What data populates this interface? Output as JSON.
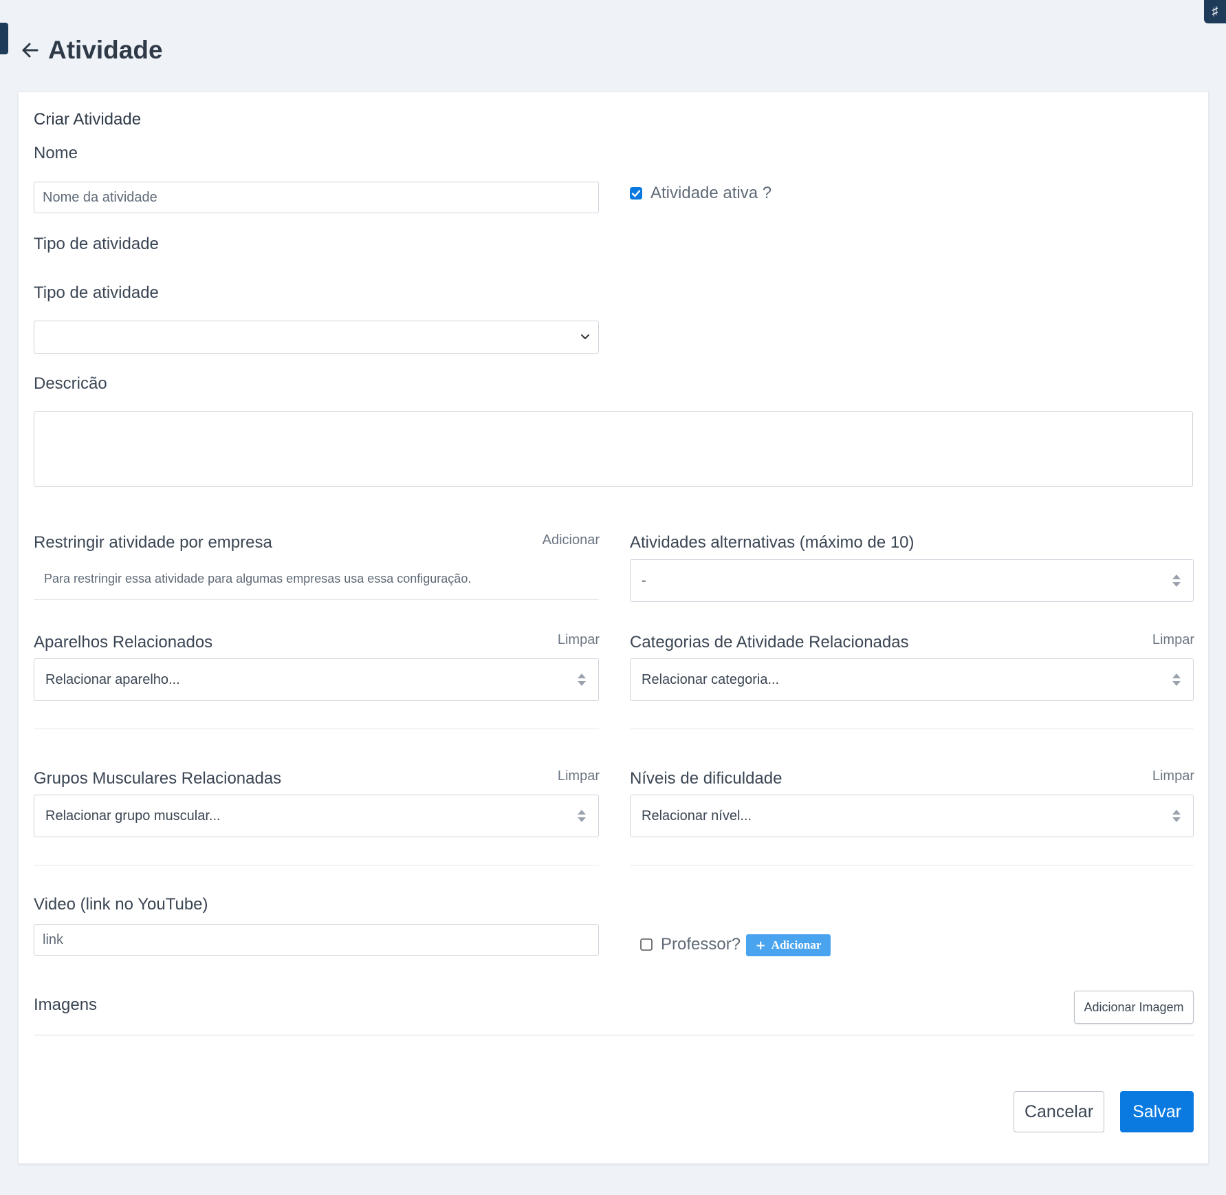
{
  "header": {
    "title": "Atividade"
  },
  "corner_icon": "person-icon",
  "form": {
    "card_title": "Criar Atividade",
    "nome_label": "Nome",
    "nome_placeholder": "Nome da atividade",
    "ativa_label": "Atividade ativa ?",
    "ativa_checked": true,
    "tipo_section_label": "Tipo de atividade",
    "tipo_label": "Tipo de atividade",
    "tipo_value": "",
    "descricao_label": "Descricão",
    "restringir_label": "Restringir atividade por empresa",
    "restringir_add": "Adicionar",
    "restringir_help": "Para restringir essa atividade para algumas empresas usa essa configuração.",
    "alternativas_label": "Atividades alternativas (máximo de 10)",
    "alternativas_value": "-",
    "aparelhos_label": "Aparelhos Relacionados",
    "aparelhos_clear": "Limpar",
    "aparelhos_placeholder": "Relacionar aparelho...",
    "categorias_label": "Categorias de Atividade Relacionadas",
    "categorias_clear": "Limpar",
    "categorias_placeholder": "Relacionar categoria...",
    "grupos_label": "Grupos Musculares Relacionadas",
    "grupos_clear": "Limpar",
    "grupos_placeholder": "Relacionar grupo muscular...",
    "niveis_label": "Níveis de dificuldade",
    "niveis_clear": "Limpar",
    "niveis_placeholder": "Relacionar nível...",
    "video_label": "Video (link no YouTube)",
    "video_placeholder": "link",
    "professor_label": "Professor?",
    "professor_checked": false,
    "professor_add": "Adicionar",
    "imagens_label": "Imagens",
    "add_image": "Adicionar Imagem",
    "cancel": "Cancelar",
    "save": "Salvar"
  },
  "colors": {
    "primary": "#0a7ae0",
    "secondary_button": "#4aa3ee",
    "background": "#eff2f6",
    "dark_tab": "#1f3b5a"
  }
}
